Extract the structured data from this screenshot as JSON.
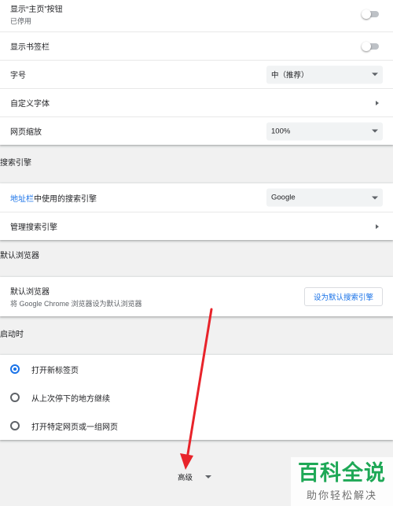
{
  "appearance": {
    "home_button": {
      "label": "显示“主页”按钮",
      "sub": "已停用"
    },
    "bookmarks_bar": {
      "label": "显示书签栏"
    },
    "font_size": {
      "label": "字号",
      "value": "中（推荐）"
    },
    "custom_fonts": {
      "label": "自定义字体"
    },
    "page_zoom": {
      "label": "网页缩放",
      "value": "100%"
    }
  },
  "search_engine": {
    "title": "搜索引擎",
    "address_bar": {
      "link": "地址栏",
      "label_rest": "中使用的搜索引擎",
      "value": "Google"
    },
    "manage": {
      "label": "管理搜索引擎"
    }
  },
  "default_browser": {
    "title": "默认浏览器",
    "label": "默认浏览器",
    "sub": "将 Google Chrome 浏览器设为默认浏览器",
    "button": "设为默认搜索引擎"
  },
  "on_startup": {
    "title": "启动时",
    "options": [
      {
        "label": "打开新标签页",
        "selected": true
      },
      {
        "label": "从上次停下的地方继续",
        "selected": false
      },
      {
        "label": "打开特定网页或一组网页",
        "selected": false
      }
    ]
  },
  "advanced": {
    "label": "高级"
  },
  "watermark": {
    "main": "百科全说",
    "sub": "助你轻松解决"
  },
  "colors": {
    "accent": "#1a73e8",
    "arrow": "#e8232a",
    "watermark": "#1ea856"
  }
}
